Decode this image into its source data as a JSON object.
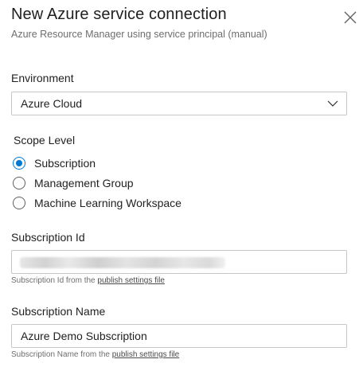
{
  "header": {
    "title": "New Azure service connection",
    "subtitle": "Azure Resource Manager using service principal (manual)"
  },
  "environment": {
    "label": "Environment",
    "selected": "Azure Cloud"
  },
  "scope": {
    "label": "Scope Level",
    "options": [
      {
        "label": "Subscription",
        "checked": true
      },
      {
        "label": "Management Group",
        "checked": false
      },
      {
        "label": "Machine Learning Workspace",
        "checked": false
      }
    ]
  },
  "subscription_id": {
    "label": "Subscription Id",
    "help_prefix": "Subscription Id from the ",
    "help_link": "publish settings file"
  },
  "subscription_name": {
    "label": "Subscription Name",
    "value": "Azure Demo Subscription",
    "help_prefix": "Subscription Name from the ",
    "help_link": "publish settings file"
  },
  "colors": {
    "accent": "#0078d4",
    "border": "#c8c6c4",
    "muted_text": "#6e6e6e"
  },
  "icons": {
    "close": "close-icon",
    "dropdown": "chevron-down-icon"
  }
}
